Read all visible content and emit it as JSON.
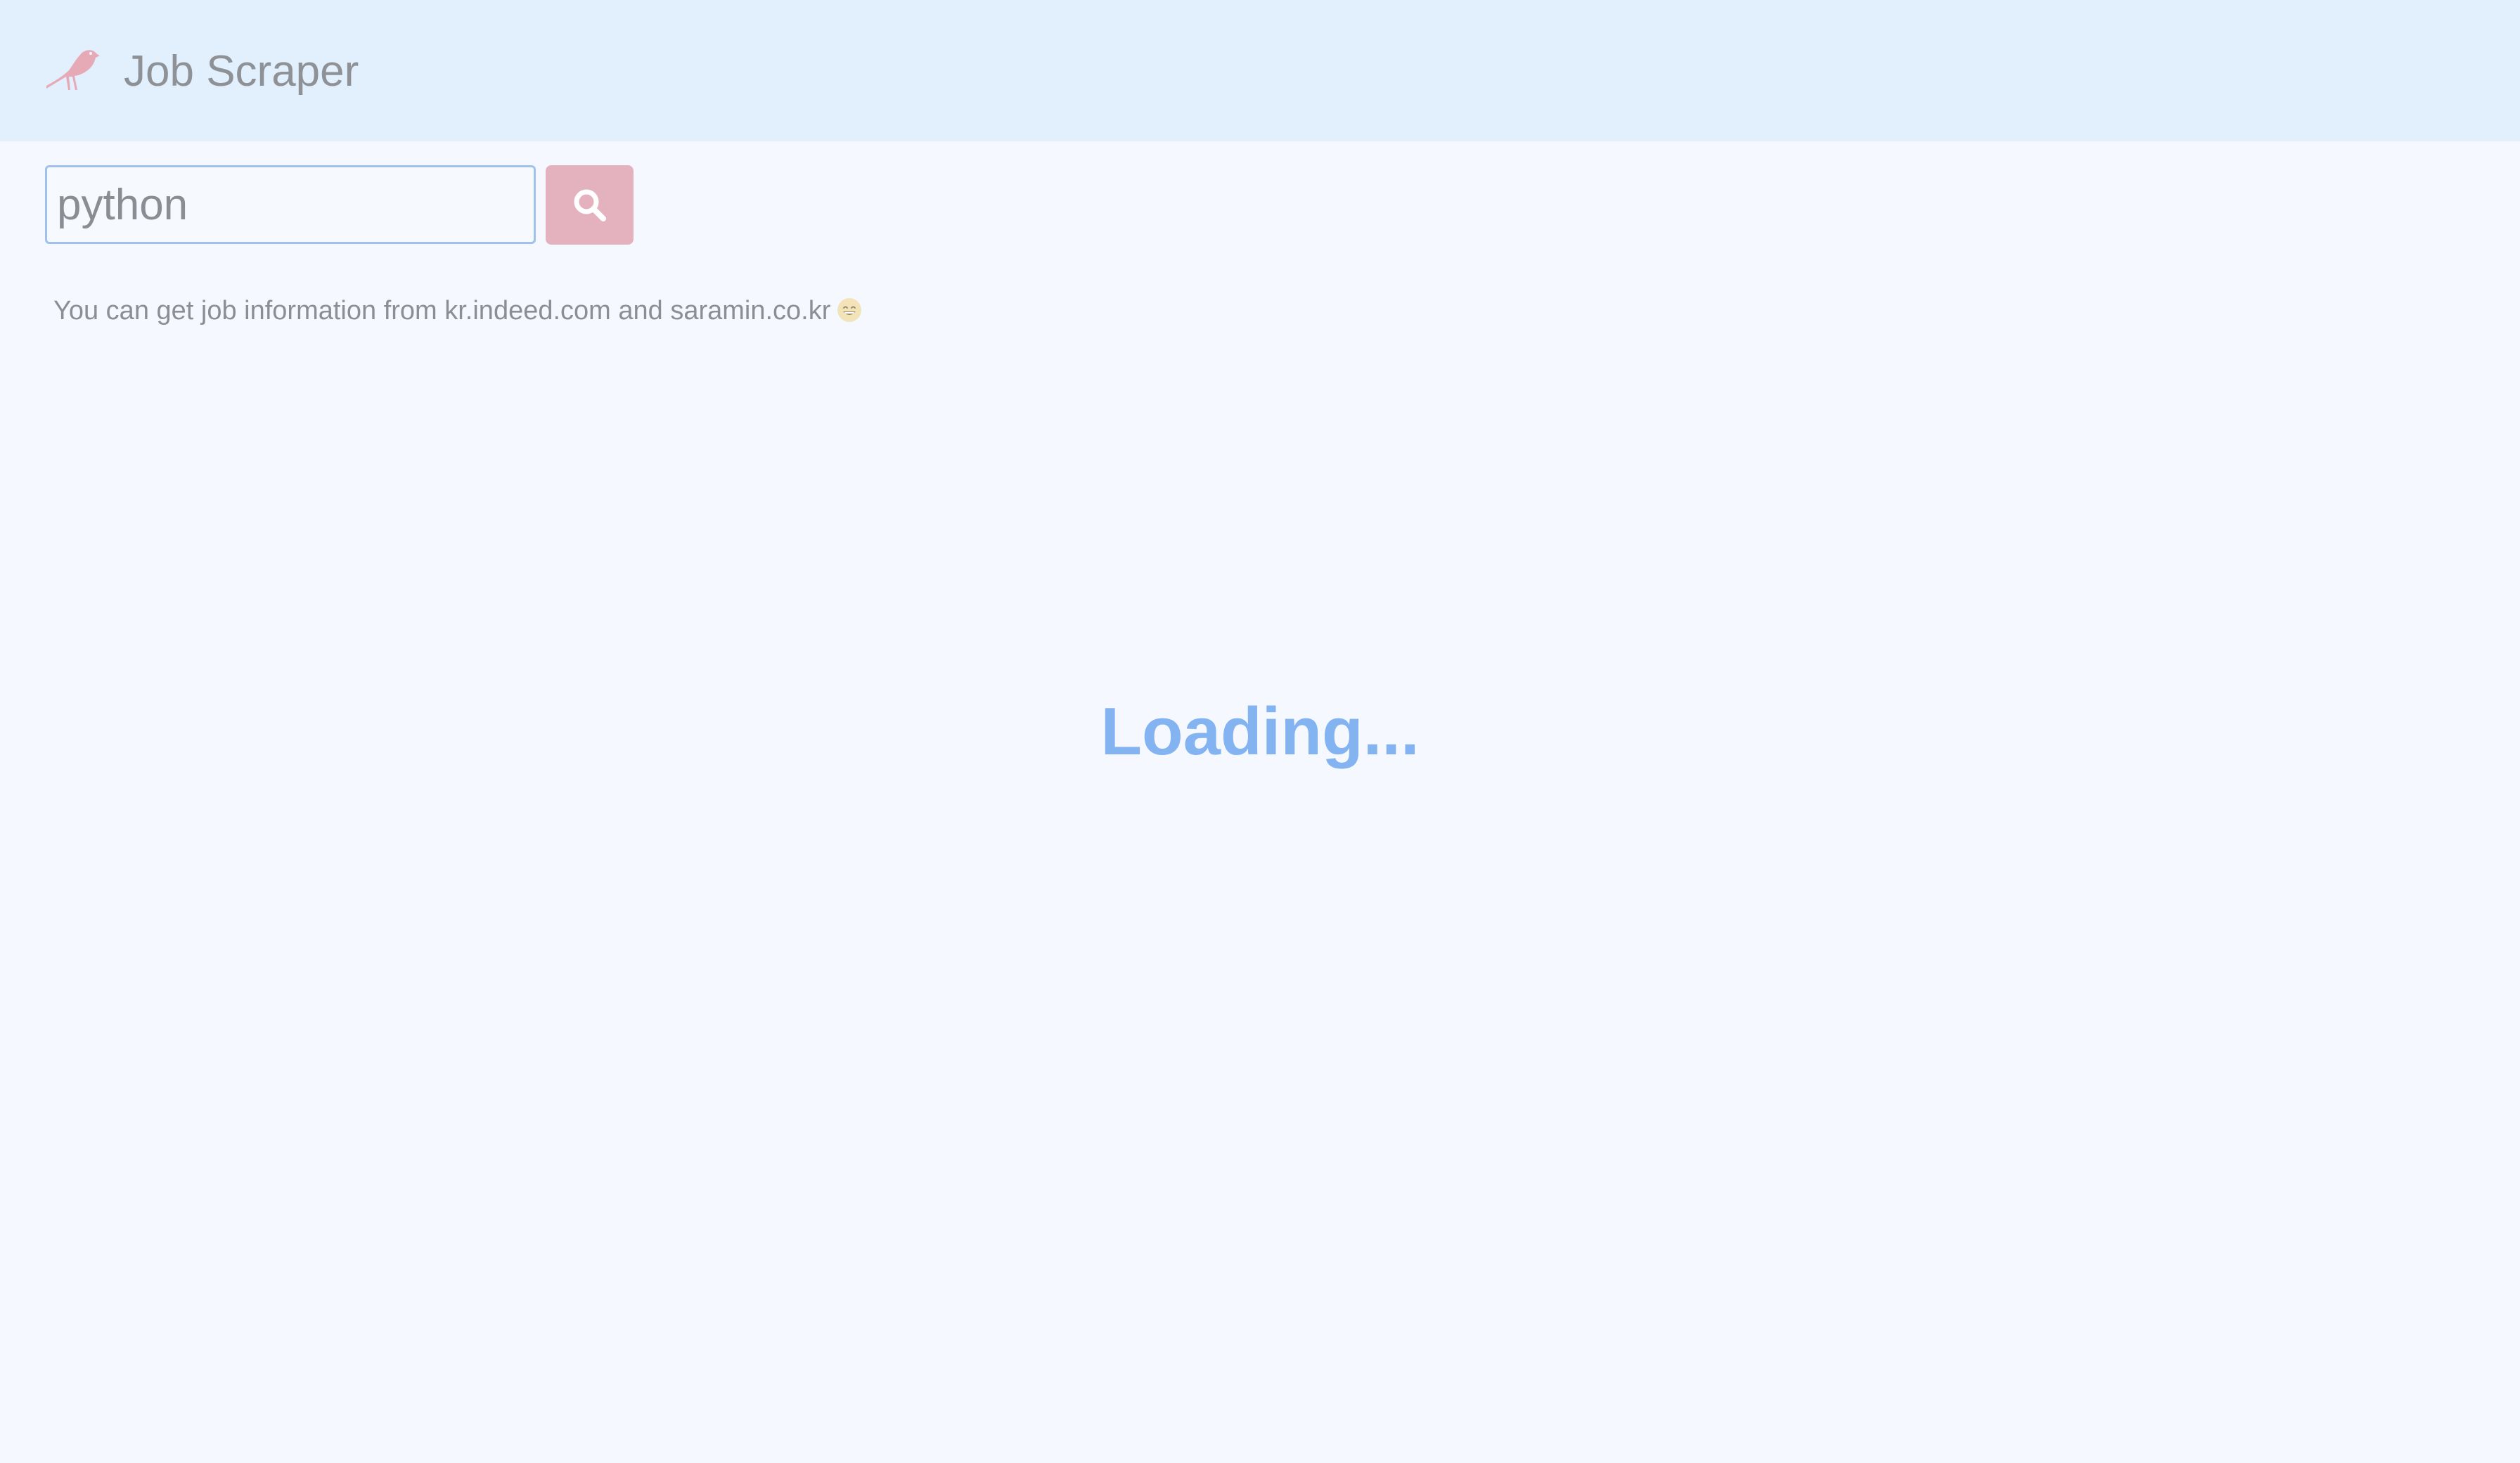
{
  "app": {
    "title": "Job Scraper",
    "logo_icon": "bird-icon",
    "colors": {
      "header_bg": "#e2effd",
      "page_bg": "#f5f9ff",
      "accent_pink": "#e4b2be",
      "loading_blue": "#84b3f1",
      "input_border": "#9fc1ec"
    }
  },
  "search": {
    "value": "python",
    "button_icon": "search-icon"
  },
  "info": {
    "text": "You can get job information from kr.indeed.com and saramin.co.kr",
    "emoji_icon": "smile-icon"
  },
  "status": {
    "loading": "Loading..."
  }
}
